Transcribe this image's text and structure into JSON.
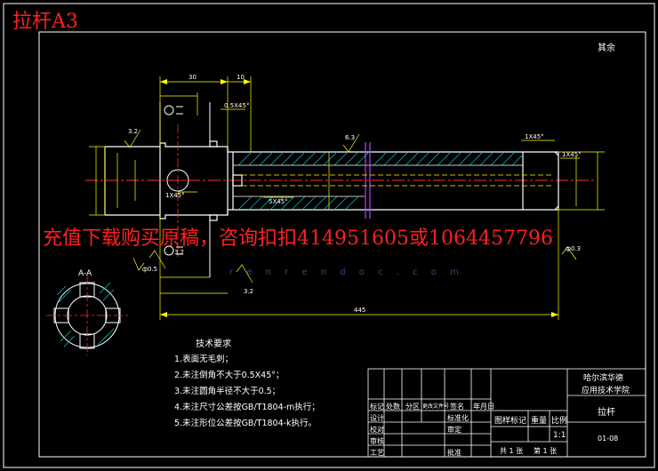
{
  "header": {
    "title": "拉杆A3",
    "rest_roughness": "其余"
  },
  "banner": {
    "text": "充值下载购买原稿，咨询扣扣414951605或1064457796"
  },
  "watermark": {
    "text": "r e n r e n d o c . c o m"
  },
  "section_label": "A-A",
  "dimensions": {
    "top_30": "30",
    "top_10": "10",
    "overall_length": "445",
    "chamfer_1": "1X45°",
    "chamfer_2": "1X45°",
    "chamfer_3": "1X45°",
    "chamfer_4": "0.5X45°",
    "chamfer_5": "5X45°",
    "roughness_32a": "3.2",
    "roughness_32b": "3.2",
    "roughness_32c": "3.2",
    "roughness_63": "6.3",
    "tol_a": "ф0.5",
    "tol_b": "ф0.3"
  },
  "tech_requirements": {
    "title": "技术要求",
    "items": [
      "1.表面无毛刺；",
      "2.未注倒角不大于0.5X45°；",
      "3.未注圆角半径不大于0.5；",
      "4.未注尺寸公差按GB/T1804-m执行；",
      "5.未注形位公差按GB/T1804-k执行。"
    ]
  },
  "title_block": {
    "school_line1": "哈尔滨华德",
    "school_line2": "应用技术学院",
    "part_name": "拉杆",
    "drawing_no": "01-08",
    "scale": "1:1",
    "stage_mark": "图样标记",
    "weight": "重量",
    "ratio": "比例",
    "sheet_total": "共 1 张",
    "sheet_no": "第 1 张",
    "row_labels": [
      "标记",
      "设计",
      "校对",
      "审核",
      "工艺"
    ],
    "col_labels": [
      "处数",
      "分区",
      "更改文件号",
      "签名",
      "年月日"
    ],
    "sign_labels": [
      "标准化",
      "审定",
      "批准"
    ]
  }
}
